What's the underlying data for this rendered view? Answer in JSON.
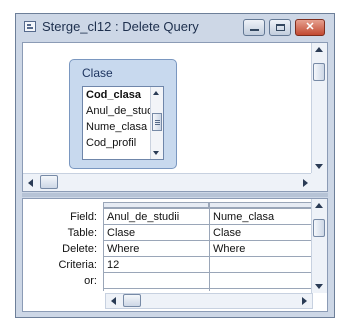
{
  "window": {
    "title": "Sterge_cl12 : Delete Query"
  },
  "table_pane": {
    "table_name": "Clase",
    "fields": [
      "Cod_clasa",
      "Anul_de_studii",
      "Nume_clasa",
      "Cod_profil"
    ]
  },
  "design_grid": {
    "row_labels": {
      "field": "Field:",
      "table": "Table:",
      "delete": "Delete:",
      "criteria": "Criteria:",
      "or": "or:"
    },
    "columns": [
      {
        "field": "Anul_de_studii",
        "table": "Clase",
        "delete": "Where",
        "criteria": "12",
        "or": ""
      },
      {
        "field": "Nume_clasa",
        "table": "Clase",
        "delete": "Where",
        "criteria": "",
        "or": ""
      }
    ]
  }
}
